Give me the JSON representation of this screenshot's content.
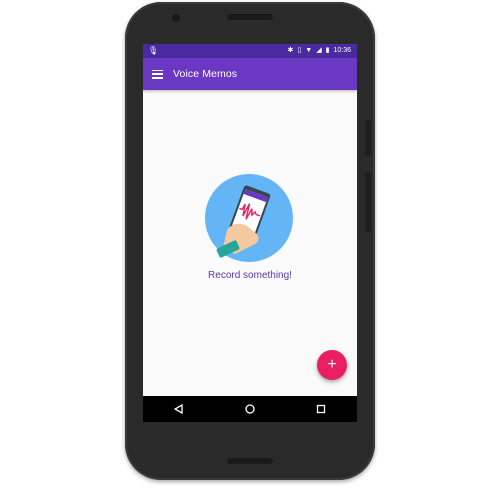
{
  "status_bar": {
    "left_icon": "mic-icon",
    "right_icons": [
      "bluetooth-icon",
      "vibrate-icon",
      "wifi-icon",
      "signal-icon",
      "battery-icon"
    ],
    "time": "10:36"
  },
  "app_bar": {
    "menu_icon": "menu-icon",
    "title": "Voice Memos"
  },
  "empty_state": {
    "illustration": "phone-recording-illustration",
    "message": "Record something!"
  },
  "fab": {
    "label": "+",
    "icon": "add-icon"
  },
  "nav_bar": {
    "buttons": [
      "back-icon",
      "home-icon",
      "recents-icon"
    ]
  },
  "colors": {
    "status_bar": "#4a2aa0",
    "app_bar": "#6a38c2",
    "accent": "#e91e63",
    "empty_text": "#5a3aa8",
    "hero_circle": "#64b5f6"
  }
}
